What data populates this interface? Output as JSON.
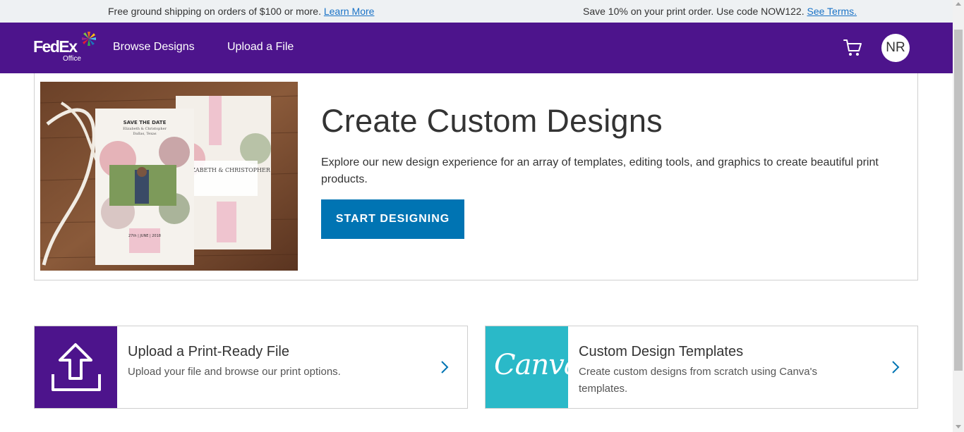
{
  "promo": {
    "left_text": "Free ground shipping on orders of $100 or more.",
    "left_link": "Learn More",
    "right_text": "Save 10% on your print order. Use code NOW122.",
    "right_link": "See Terms."
  },
  "header": {
    "logo_main": "FedEx",
    "logo_sub": "Office",
    "nav": [
      "Browse Designs",
      "Upload a File"
    ],
    "avatar_initials": "NR",
    "cart_icon": "cart-icon",
    "brand_color": "#4d148c"
  },
  "hero": {
    "title": "Create Custom Designs",
    "description": "Explore our new design experience for an array of templates, editing tools, and graphics to create beautiful print products.",
    "button": "START DESIGNING",
    "button_color": "#0074b3",
    "image": {
      "card_left_heading": "SAVE THE DATE",
      "card_left_names": "Elizabeth & Christopher",
      "card_left_place": "Dallas, Texas",
      "card_left_date": "27th | JUNE | 2018",
      "card_right_names": "ELIZABETH & CHRISTOPHER"
    }
  },
  "options": [
    {
      "title": "Upload a Print-Ready File",
      "description": "Upload your file and browse our print options.",
      "icon": "upload-icon",
      "tile_color": "#4d148c"
    },
    {
      "title": "Custom Design Templates",
      "description": "Create custom designs from scratch using Canva's templates.",
      "icon": "canva-logo",
      "logo_text": "Canva",
      "tile_color": "#2ab9c8"
    }
  ]
}
